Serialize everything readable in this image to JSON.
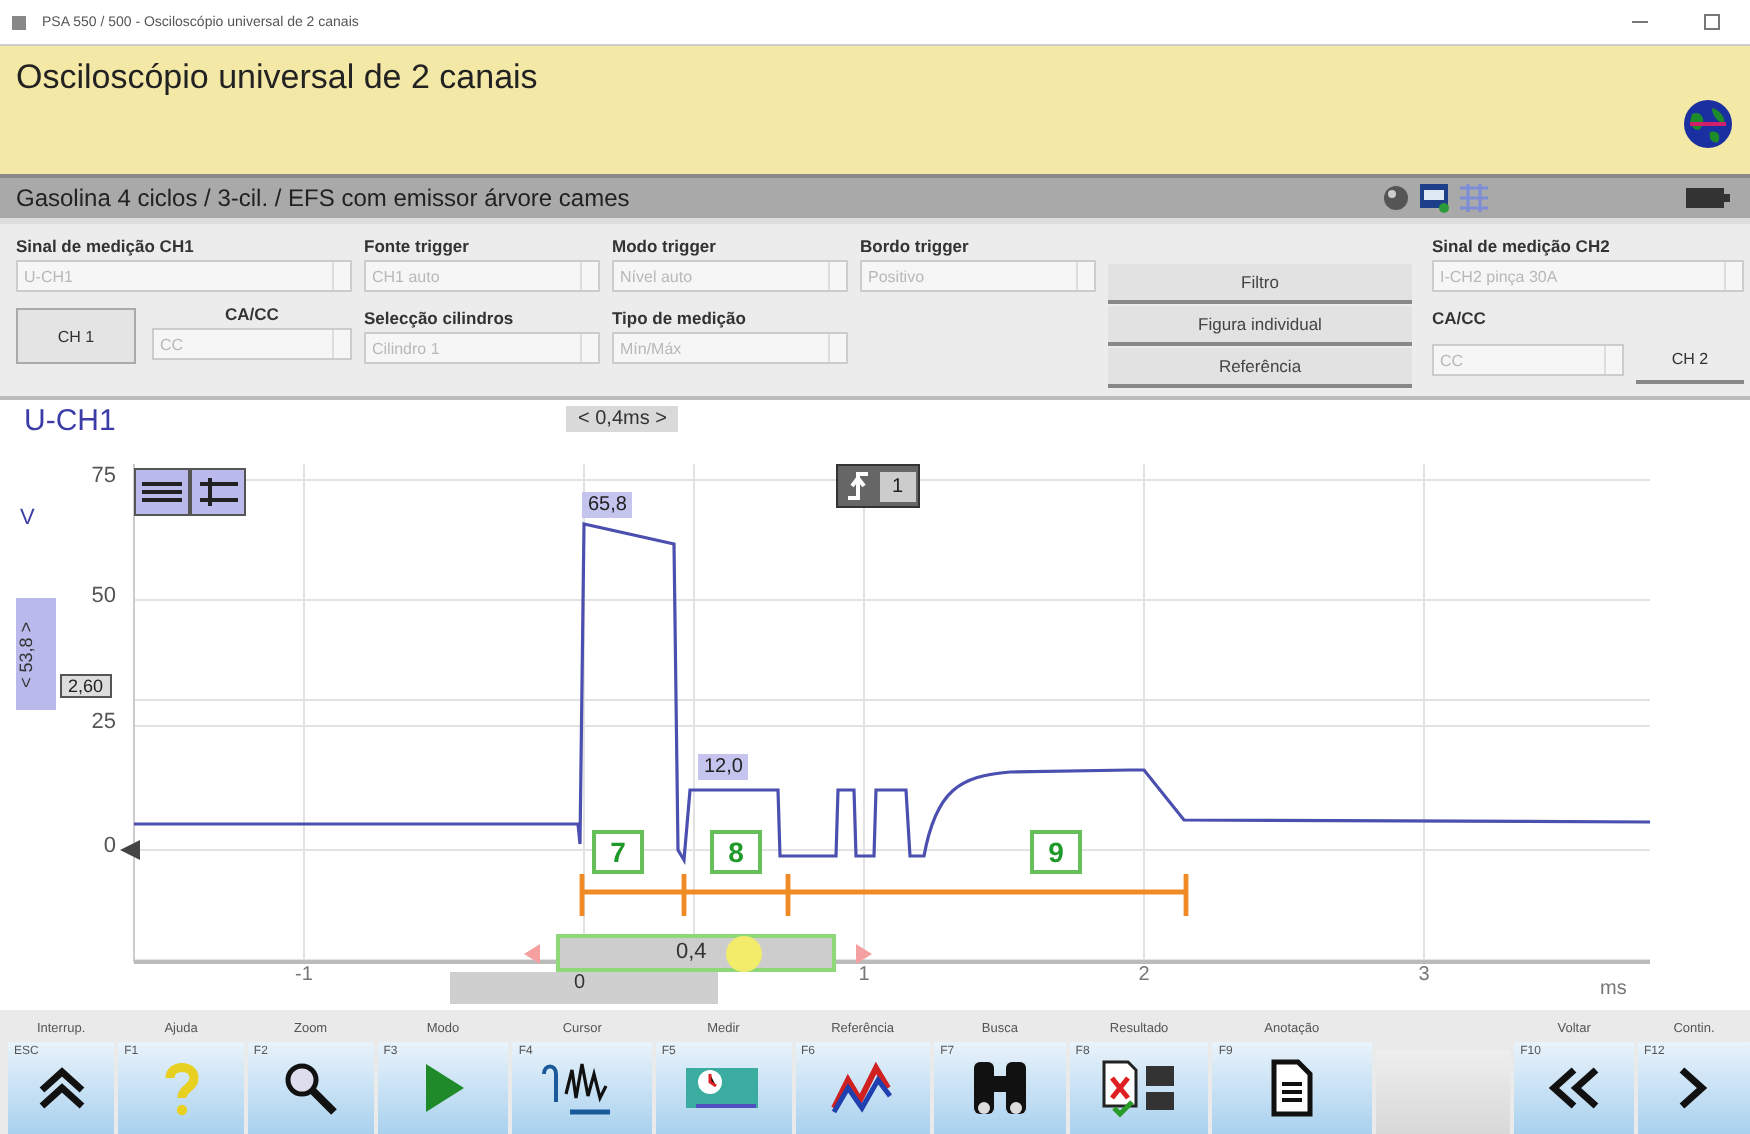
{
  "window": {
    "title": "PSA 550 / 500 - Osciloscópio universal de 2 canais"
  },
  "header": {
    "title": "Osciloscópio universal de 2 canais"
  },
  "vehicle_bar": {
    "text": "Gasolina 4 ciclos / 3-cil. / EFS com emissor árvore cames"
  },
  "settings": {
    "row1": [
      {
        "label": "Sinal de medição CH1",
        "value": "U-CH1",
        "disabled": true
      },
      {
        "label": "Fonte trigger",
        "value": "CH1 auto",
        "disabled": true
      },
      {
        "label": "Modo trigger",
        "value": "Nível auto",
        "disabled": true
      },
      {
        "label": "Bordo trigger",
        "value": "Positivo",
        "disabled": true
      }
    ],
    "row2": [
      {
        "label": "CA/CC",
        "value": "CC",
        "disabled": true
      },
      {
        "label": "Selecção cilindros",
        "value": "Cilindro 1",
        "disabled": true
      },
      {
        "label": "Tipo de medição",
        "value": "Mín/Máx",
        "disabled": true
      }
    ],
    "buttons": [
      "Filtro",
      "Figura individual",
      "Referência"
    ],
    "ch2": [
      {
        "label": "Sinal de medição CH2",
        "value": "I-CH2 pinça 30A",
        "disabled": true
      },
      {
        "label": "CA/CC",
        "value": "CC",
        "disabled": true
      }
    ],
    "channel_buttons": [
      "CH 1",
      "CH 2"
    ]
  },
  "plot": {
    "channel": "U-CH1",
    "timebase": "< 0,4ms >",
    "y_unit": "V",
    "y_ticks": [
      "75",
      "50",
      "25",
      "0"
    ],
    "x_ticks": [
      "-1",
      "1",
      "2",
      "3"
    ],
    "x_unit": "ms",
    "peak_label": "65,8",
    "plateau_label": "12,0",
    "cursor_value": "2,60",
    "range_label": "< 53,8 >",
    "trigger_channel": "1",
    "annotations": [
      "7",
      "8",
      "9"
    ],
    "slider": {
      "value": "0,4",
      "level": 0.68
    },
    "offset_value": "0"
  },
  "toolbar": [
    {
      "label": "Interrup.",
      "key": "ESC"
    },
    {
      "label": "Ajuda",
      "key": "F1"
    },
    {
      "label": "Zoom",
      "key": "F2"
    },
    {
      "label": "Modo",
      "key": "F3"
    },
    {
      "label": "Cursor",
      "key": "F4"
    },
    {
      "label": "Medir",
      "key": "F5"
    },
    {
      "label": "Referência",
      "key": "F6"
    },
    {
      "label": "Busca",
      "key": "F7"
    },
    {
      "label": "Resultado",
      "key": "F8"
    },
    {
      "label": "Anotação",
      "key": "F9"
    },
    {
      "label": "Voltar",
      "key": "F10"
    },
    {
      "label": "Contin.",
      "key": "F12"
    }
  ]
}
